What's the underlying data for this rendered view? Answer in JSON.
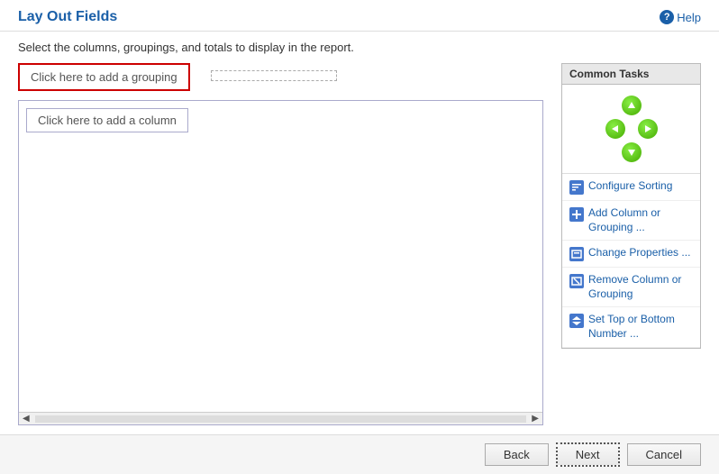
{
  "header": {
    "title": "Lay Out Fields",
    "help_label": "Help"
  },
  "subtitle": "Select the columns, groupings, and totals to display in the report.",
  "grouping": {
    "placeholder_text": "Click here to add a grouping",
    "child_placeholder_text": ""
  },
  "column": {
    "placeholder_text": "Click here to add a column"
  },
  "common_tasks": {
    "header": "Common Tasks",
    "items": [
      {
        "label": "Configure Sorting",
        "icon": "sort-icon"
      },
      {
        "label": "Add Column or\nGrouping ...",
        "icon": "add-icon"
      },
      {
        "label": "Change Properties ...",
        "icon": "props-icon"
      },
      {
        "label": "Remove Column or\nGrouping",
        "icon": "props-icon"
      },
      {
        "label": "Set Top or Bottom\nNumber ...",
        "icon": "topbottom-icon"
      }
    ]
  },
  "footer": {
    "back_label": "Back",
    "next_label": "Next",
    "cancel_label": "Cancel"
  }
}
